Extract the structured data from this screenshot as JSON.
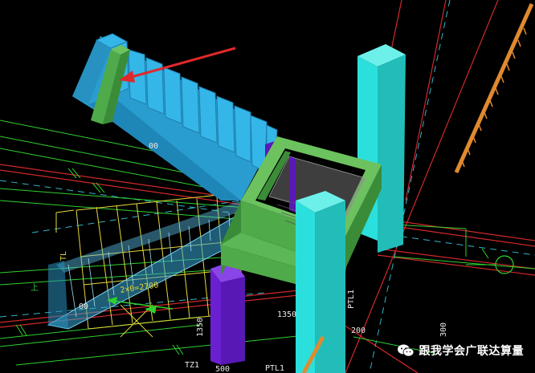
{
  "labels": {
    "dim_stair": "2×0=2700",
    "dim_1350": "1350",
    "dim_500": "500",
    "tag_tl": "TL",
    "tag_tz1": "TZ1",
    "tag_ptl1_bottom": "PTL1",
    "tag_ptl1_right": "PTL1",
    "dim_200": "200",
    "dim_300": "300",
    "dim_1350_vertical": "1350",
    "tag_up": "上",
    "axis_circle": "",
    "dim_small_left": "00",
    "dim_small_bottom": "00"
  },
  "watermark": {
    "text": "跟我学会广联达算量",
    "icon": "wechat-icon"
  },
  "colors": {
    "stair_blue": "#2fb0e0",
    "column_cyan": "#2be0dc",
    "beam_green": "#4faa4a",
    "column_purple": "#6a1fd0",
    "railing_orange": "#e08a30",
    "annotation_red": "#e0282a"
  }
}
